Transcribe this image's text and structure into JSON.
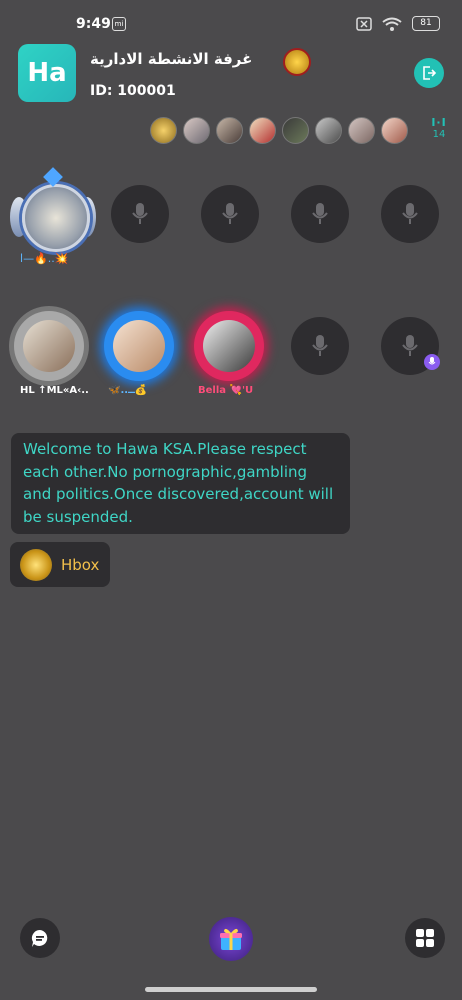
{
  "status_bar": {
    "time": "9:49",
    "notif_icon": "mi",
    "battery": "81"
  },
  "room": {
    "logo_text": "Ha",
    "title": "غرفة الانشطة الادارية",
    "id_text": "ID: 100001"
  },
  "audience": {
    "count": "14",
    "count_icon": "I·I"
  },
  "seats": {
    "host_name": "ا—🔥..💥",
    "row2": [
      {
        "label": "HL ↑ML«A‹..",
        "label_color": "#ffffff"
      },
      {
        "label": "🦋..ــ💰",
        "label_color": "#5eb7ff"
      },
      {
        "label": "Bella 💘'U",
        "label_color": "#ff4d7a"
      }
    ]
  },
  "messages": {
    "welcome": "Welcome to Hawa KSA.Please respect each other.No pornographic,gambling and politics.Once discovered,account will be suspended.",
    "hbox_label": "Hbox"
  },
  "colors": {
    "accent": "#22c1b5",
    "background": "#4b4a4c",
    "seat_bg": "#2e2d30",
    "welcome_text": "#3fd6c6",
    "hbox_text": "#f3c04b"
  }
}
